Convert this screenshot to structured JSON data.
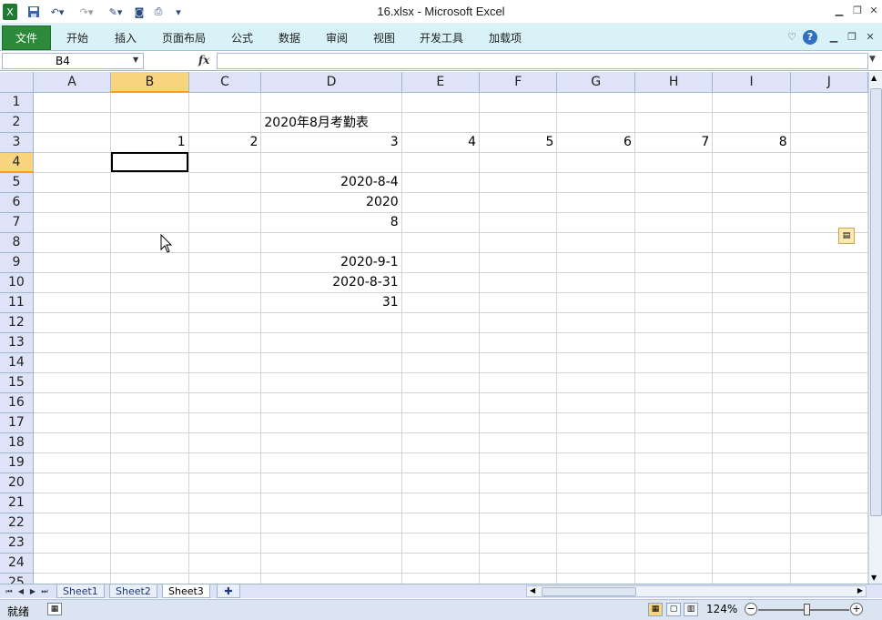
{
  "app": {
    "window_title": "16.xlsx  -  Microsoft Excel",
    "ribbon_tabs": [
      "文件",
      "开始",
      "插入",
      "页面布局",
      "公式",
      "数据",
      "审阅",
      "视图",
      "开发工具",
      "加载项"
    ]
  },
  "formula_bar": {
    "name_box": "B4",
    "fx_label": "fx",
    "formula": ""
  },
  "grid": {
    "columns": [
      "A",
      "B",
      "C",
      "D",
      "E",
      "F",
      "G",
      "H",
      "I",
      "J"
    ],
    "rows": [
      "1",
      "2",
      "3",
      "4",
      "5",
      "6",
      "7",
      "8",
      "9",
      "10",
      "11",
      "12",
      "13",
      "14",
      "15",
      "16",
      "17",
      "18",
      "19",
      "20",
      "21",
      "22",
      "23",
      "24",
      "25"
    ],
    "cells": {
      "D2": "2020年8月考勤表",
      "B3": "1",
      "C3": "2",
      "D3": "3",
      "E3": "4",
      "F3": "5",
      "G3": "6",
      "H3": "7",
      "I3": "8",
      "D5": "2020-8-4",
      "D6": "2020",
      "D7": "8",
      "D9": "2020-9-1",
      "D10": "2020-8-31",
      "D11": "31"
    },
    "selected_cell": "B4"
  },
  "sheets": {
    "tabs": [
      "Sheet1",
      "Sheet2",
      "Sheet3"
    ],
    "active": "Sheet3"
  },
  "status": {
    "ready_text": "就绪",
    "zoom": "124%"
  }
}
